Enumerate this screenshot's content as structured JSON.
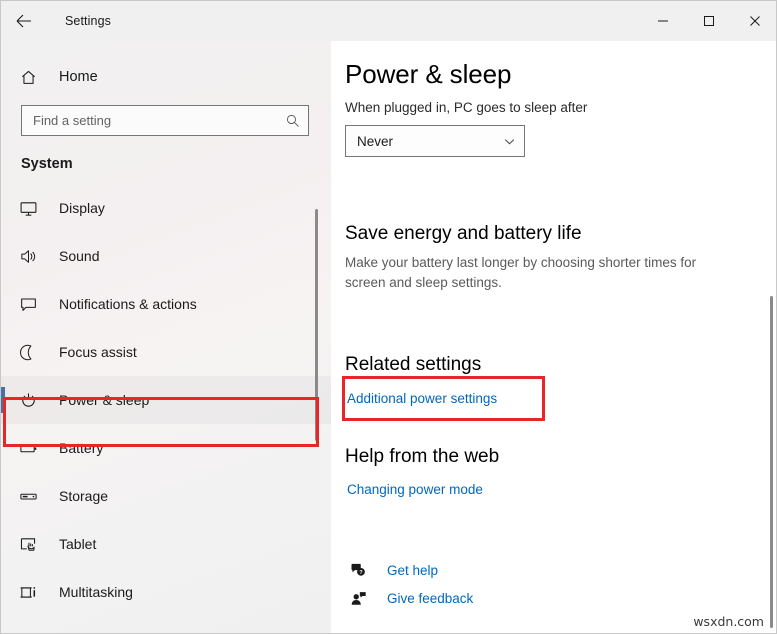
{
  "window": {
    "title": "Settings",
    "back_icon": "back-arrow-icon",
    "minimize_label": "─",
    "maximize_label": "□",
    "close_label": "✕"
  },
  "sidebar": {
    "home_label": "Home",
    "home_icon": "home-icon",
    "search": {
      "placeholder": "Find a setting",
      "value": "",
      "icon": "search-icon"
    },
    "group_title": "System",
    "scrollbar": "sidebar-scrollbar",
    "items": [
      {
        "label": "Display",
        "icon": "monitor-icon",
        "selected": false
      },
      {
        "label": "Sound",
        "icon": "speaker-icon",
        "selected": false
      },
      {
        "label": "Notifications & actions",
        "icon": "chat-bubble-icon",
        "selected": false
      },
      {
        "label": "Focus assist",
        "icon": "moon-icon",
        "selected": false
      },
      {
        "label": "Power & sleep",
        "icon": "power-icon",
        "selected": true
      },
      {
        "label": "Battery",
        "icon": "battery-icon",
        "selected": false
      },
      {
        "label": "Storage",
        "icon": "drive-icon",
        "selected": false
      },
      {
        "label": "Tablet",
        "icon": "tablet-icon",
        "selected": false
      },
      {
        "label": "Multitasking",
        "icon": "multitasking-icon",
        "selected": false
      }
    ]
  },
  "main": {
    "page_title": "Power & sleep",
    "sleep": {
      "label": "When plugged in, PC goes to sleep after",
      "selected_value": "Never",
      "chevron_icon": "chevron-down-icon"
    },
    "save_energy": {
      "heading": "Save energy and battery life",
      "description": "Make your battery last longer by choosing shorter times for screen and sleep settings."
    },
    "related_settings": {
      "heading": "Related settings",
      "link": "Additional power settings"
    },
    "help_from_web": {
      "heading": "Help from the web",
      "link": "Changing power mode"
    },
    "footer": [
      {
        "label": "Get help",
        "icon": "question-bubble-icon"
      },
      {
        "label": "Give feedback",
        "icon": "feedback-person-icon"
      }
    ],
    "scrollbar": "main-scrollbar"
  },
  "annotations": {
    "color": "#e8262a",
    "sidebar_highlight_target": "Power & sleep",
    "link_highlight_target": "Additional power settings"
  },
  "watermark": "wsxdn.com",
  "colors": {
    "accent_link": "#0067c0",
    "annotation_red": "#e8262a",
    "selected_bar": "#4a6fa5",
    "sidebar_bg": "#f2f0f1"
  }
}
